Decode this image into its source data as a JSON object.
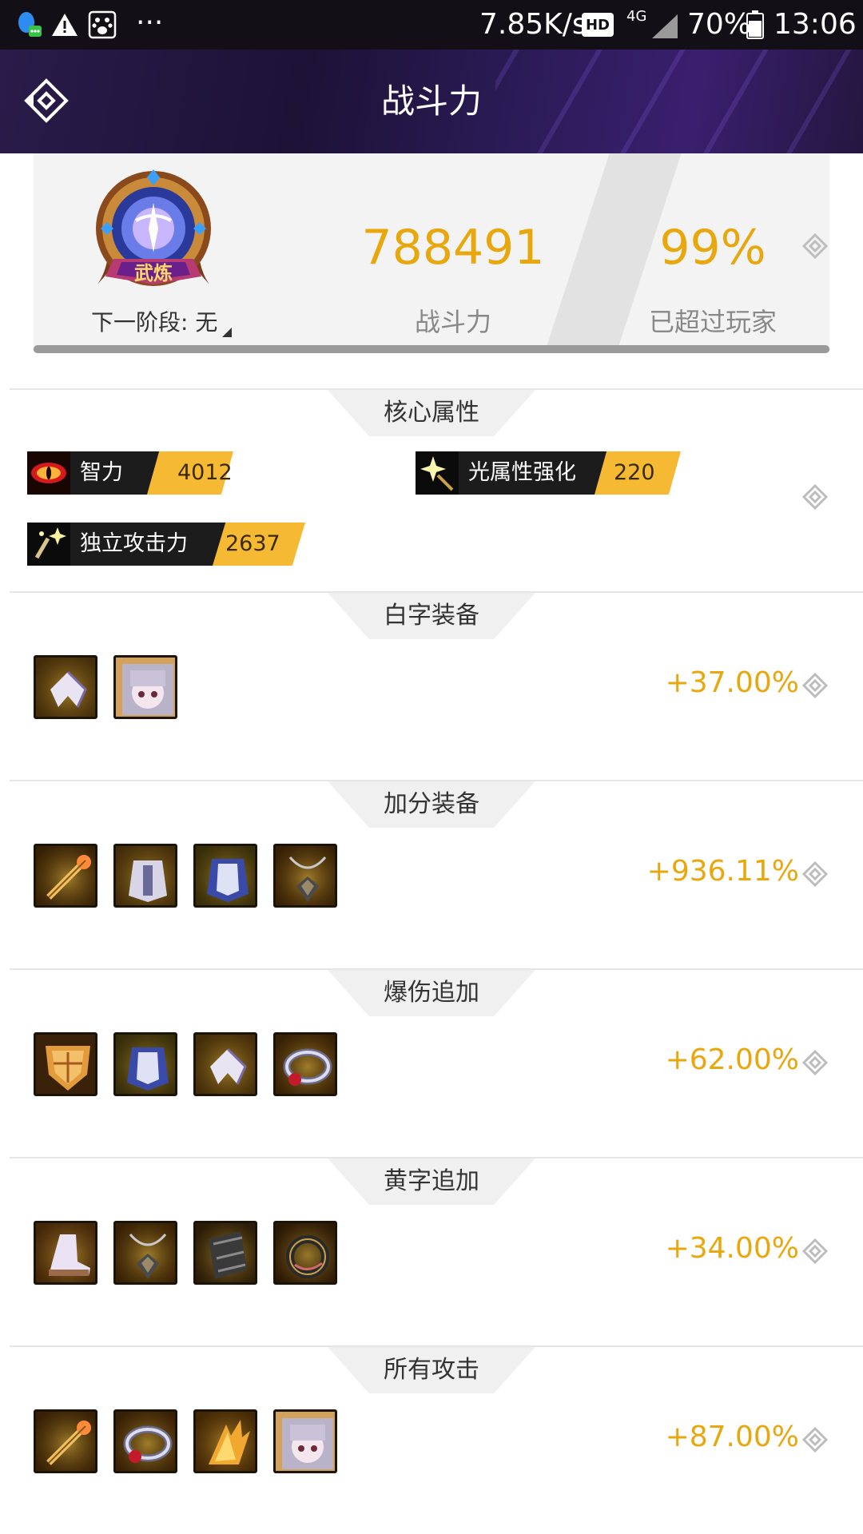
{
  "status_bar": {
    "net_speed": "7.85K/s",
    "hd_badge": "HD",
    "network": "4G",
    "battery": "70%",
    "time": "13:06",
    "more": "···"
  },
  "header": {
    "title": "战斗力"
  },
  "summary": {
    "badge_text": "武炼",
    "next_stage": "下一阶段: 无",
    "power_value": "788491",
    "power_label": "战斗力",
    "rank_value": "99%",
    "rank_label": "已超过玩家",
    "progress_fraction": 1.0
  },
  "core": {
    "title": "核心属性",
    "attributes": [
      {
        "name": "智力",
        "value": "4012",
        "icon": "eye-icon"
      },
      {
        "name": "光属性强化",
        "value": "220",
        "icon": "light-burst-icon"
      },
      {
        "name": "独立攻击力",
        "value": "2637",
        "icon": "sword-sparkle-icon"
      }
    ]
  },
  "sections": [
    {
      "title": "白字装备",
      "bonus": "+37.00%",
      "items": [
        "wing-armor",
        "doll-portrait"
      ]
    },
    {
      "title": "加分装备",
      "bonus": "+936.11%",
      "items": [
        "golden-staff",
        "silver-armor",
        "blue-armor",
        "amulet"
      ]
    },
    {
      "title": "爆伤追加",
      "bonus": "+62.00%",
      "items": [
        "golden-shield",
        "blue-armor",
        "wing-armor",
        "ring"
      ]
    },
    {
      "title": "黄字追加",
      "bonus": "+34.00%",
      "items": [
        "boots",
        "amulet",
        "bracer",
        "dark-ring"
      ]
    },
    {
      "title": "所有攻击",
      "bonus": "+87.00%",
      "items": [
        "golden-staff",
        "ring",
        "golden-claw",
        "doll-portrait"
      ]
    }
  ],
  "colors": {
    "accent": "#e9a70e",
    "header_bg": "#1c1236",
    "tag_value_bg": "#f6b933"
  }
}
